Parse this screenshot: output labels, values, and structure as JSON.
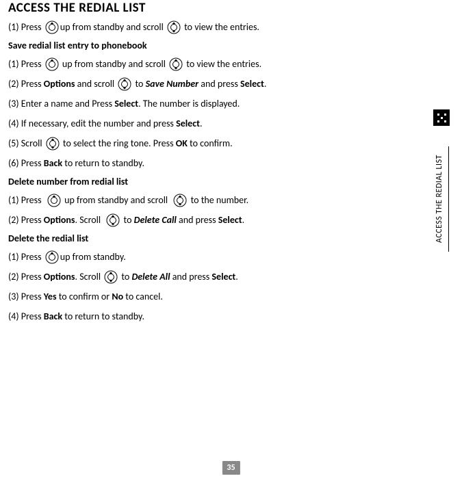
{
  "title": "ACCESS THE REDIAL LIST",
  "sidetab": "ACCESS THE REDIAL LIST",
  "pagenum": "35",
  "s1": {
    "l1a": "(1) Press ",
    "l1b": "up from standby and scroll ",
    "l1c": " to view the entries."
  },
  "h2": "Save redial list entry to phonebook",
  "s2": {
    "l1a": "(1) Press ",
    "l1b": " up from standby and scroll ",
    "l1c": " to view the entries.",
    "l2a": "(2) Press ",
    "l2b": "Options",
    "l2c": " and scroll ",
    "l2d": " to ",
    "l2e": "Save Number",
    "l2f": " and press ",
    "l2g": "Select",
    "l2h": ".",
    "l3a": "(3) Enter a name and Press ",
    "l3b": "Select",
    "l3c": ". The number is displayed.",
    "l4a": "(4) If necessary, edit the number and press ",
    "l4b": "Select",
    "l4c": ".",
    "l5a": "(5) Scroll ",
    "l5b": " to select the ring tone. Press ",
    "l5c": "OK",
    "l5d": " to confirm.",
    "l6a": "(6) Press ",
    "l6b": "Back",
    "l6c": " to return to standby."
  },
  "h3": "Delete number from redial list",
  "s3": {
    "l1a": "(1) Press  ",
    "l1b": " up from standby and scroll  ",
    "l1c": " to the number.",
    "l2a": "(2) Press ",
    "l2b": "Options",
    "l2c": ". Scroll  ",
    "l2d": " to ",
    "l2e": "Delete Call",
    "l2f": " and press ",
    "l2g": "Select",
    "l2h": "."
  },
  "h4": "Delete the redial list",
  "s4": {
    "l1a": "(1) Press ",
    "l1b": "up from standby.",
    "l2a": "(2) Press ",
    "l2b": "Options",
    "l2c": ". Scroll ",
    "l2d": " to ",
    "l2e": "Delete All",
    "l2f": " and press ",
    "l2g": "Select",
    "l2h": ".",
    "l3a": "(3) Press ",
    "l3b": "Yes",
    "l3c": " to confirm or ",
    "l3d": "No",
    "l3e": " to cancel.",
    "l4a": "(4) Press ",
    "l4b": "Back",
    "l4c": " to return to standby."
  }
}
